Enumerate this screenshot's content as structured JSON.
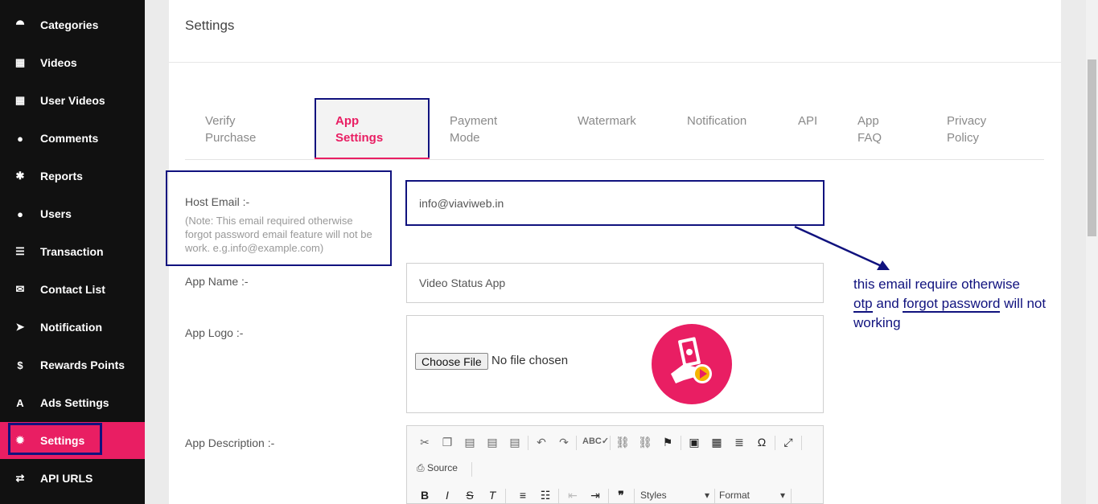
{
  "sidebar": {
    "items": [
      {
        "icon": "sitemap-icon",
        "glyph": "⯊",
        "label": "Categories"
      },
      {
        "icon": "film-icon",
        "glyph": "▦",
        "label": "Videos"
      },
      {
        "icon": "film-icon",
        "glyph": "▦",
        "label": "User Videos"
      },
      {
        "icon": "comments-icon",
        "glyph": "●",
        "label": "Comments"
      },
      {
        "icon": "bug-icon",
        "glyph": "✱",
        "label": "Reports"
      },
      {
        "icon": "users-icon",
        "glyph": "●",
        "label": "Users"
      },
      {
        "icon": "list-icon",
        "glyph": "☰",
        "label": "Transaction"
      },
      {
        "icon": "envelope-icon",
        "glyph": "✉",
        "label": "Contact List"
      },
      {
        "icon": "send-icon",
        "glyph": "➤",
        "label": "Notification"
      },
      {
        "icon": "dollar-icon",
        "glyph": "$",
        "label": "Rewards Points"
      },
      {
        "icon": "ads-icon",
        "glyph": "A",
        "label": "Ads Settings"
      },
      {
        "icon": "gear-icon",
        "glyph": "✹",
        "label": "Settings"
      },
      {
        "icon": "exchange-icon",
        "glyph": "⇄",
        "label": "API URLS"
      }
    ],
    "active_index": 11,
    "active_color": "#e91e63"
  },
  "page": {
    "title": "Settings"
  },
  "tabs": [
    {
      "line1": "Verify",
      "line2": "Purchase"
    },
    {
      "line1": "App",
      "line2": "Settings"
    },
    {
      "line1": "Payment",
      "line2": "Mode"
    },
    {
      "line1": "Watermark",
      "line2": ""
    },
    {
      "line1": "Notification",
      "line2": ""
    },
    {
      "line1": "API",
      "line2": ""
    },
    {
      "line1": "App",
      "line2": "FAQ"
    },
    {
      "line1": "Privacy",
      "line2": "Policy"
    }
  ],
  "form": {
    "host_email_label": "Host Email :-",
    "host_email_note": "(Note: This email required otherwise forgot password email feature will not be work. e.g.info@example.com)",
    "host_email_value": "info@viaviweb.in",
    "app_name_label": "App Name :-",
    "app_name_value": "Video Status App",
    "app_logo_label": "App Logo :-",
    "choose_file_label": "Choose File",
    "no_file_text": "No file chosen",
    "app_description_label": "App Description :-"
  },
  "editor": {
    "source_label": "Source",
    "styles_label": "Styles",
    "format_label": "Format"
  },
  "annotation": {
    "line1": "this email require otherwise",
    "otp": "otp",
    "and": " and ",
    "forgot_password": "forgot password",
    "line2_end": " will not",
    "line3": "working"
  },
  "colors": {
    "accent": "#e91e63",
    "annotation": "#10127e"
  }
}
